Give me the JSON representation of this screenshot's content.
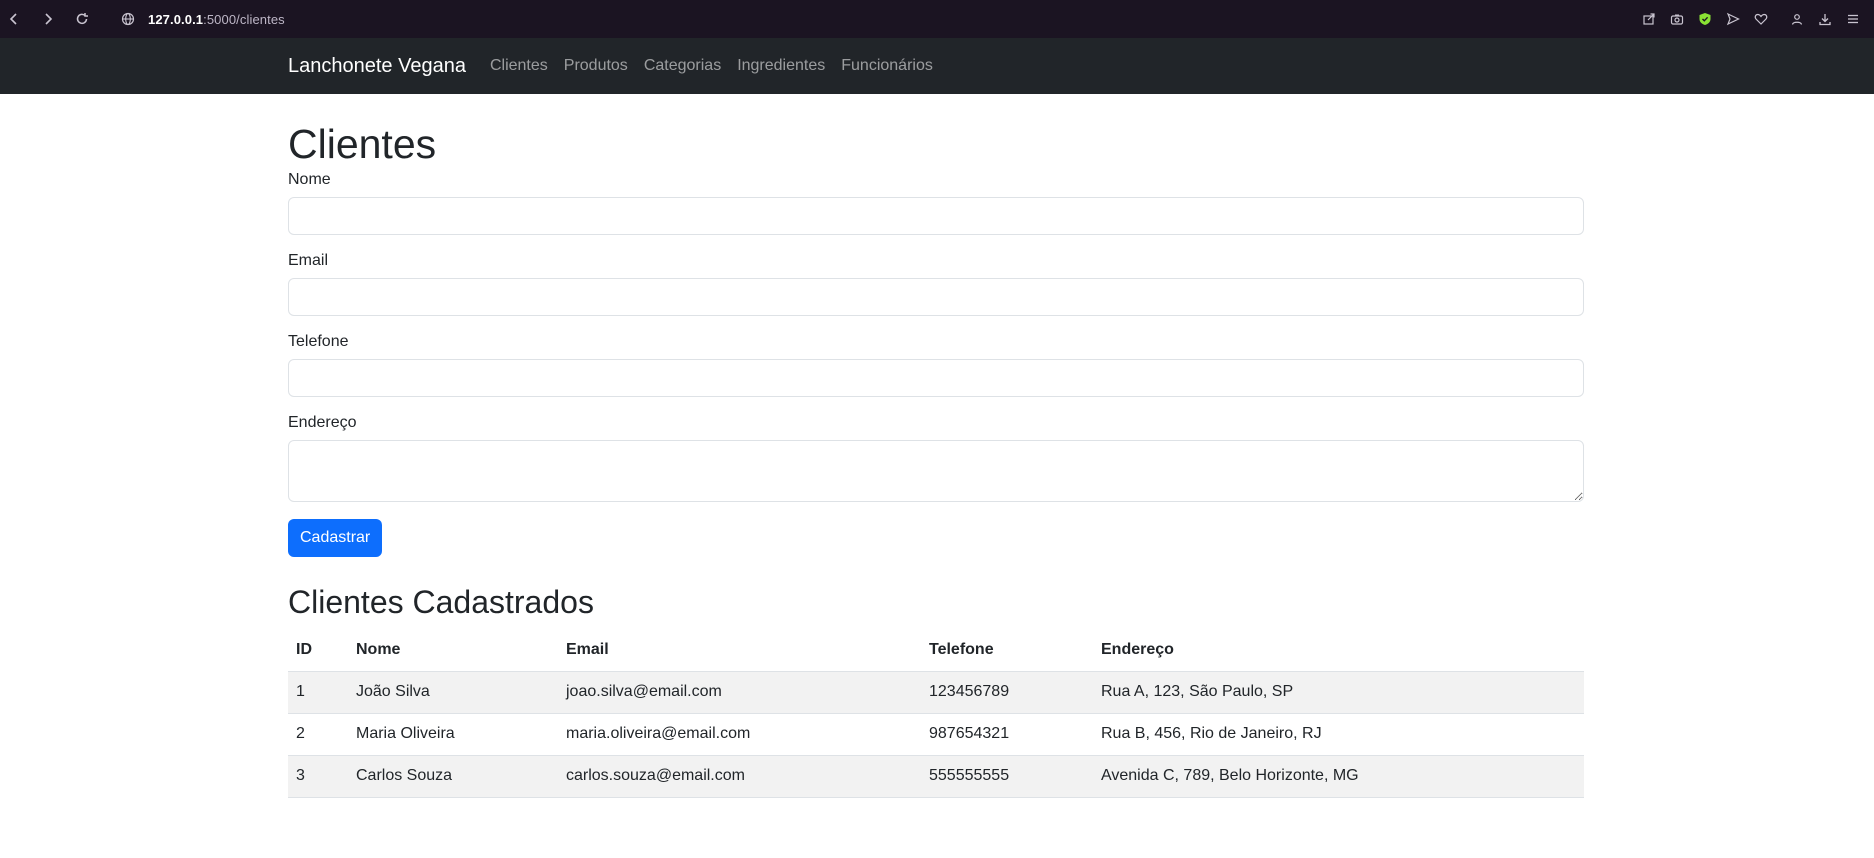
{
  "browser": {
    "url_host": "127.0.0.1",
    "url_path": ":5000/clientes"
  },
  "navbar": {
    "brand": "Lanchonete Vegana",
    "links": [
      "Clientes",
      "Produtos",
      "Categorias",
      "Ingredientes",
      "Funcionários"
    ]
  },
  "main": {
    "title": "Clientes",
    "form": {
      "nome_label": "Nome",
      "nome_value": "",
      "email_label": "Email",
      "email_value": "",
      "telefone_label": "Telefone",
      "telefone_value": "",
      "endereco_label": "Endereço",
      "endereco_value": "",
      "submit_label": "Cadastrar"
    },
    "list_title": "Clientes Cadastrados",
    "table": {
      "headers": [
        "ID",
        "Nome",
        "Email",
        "Telefone",
        "Endereço"
      ],
      "rows": [
        [
          "1",
          "João Silva",
          "joao.silva@email.com",
          "123456789",
          "Rua A, 123, São Paulo, SP"
        ],
        [
          "2",
          "Maria Oliveira",
          "maria.oliveira@email.com",
          "987654321",
          "Rua B, 456, Rio de Janeiro, RJ"
        ],
        [
          "3",
          "Carlos Souza",
          "carlos.souza@email.com",
          "555555555",
          "Avenida C, 789, Belo Horizonte, MG"
        ]
      ]
    }
  },
  "colors": {
    "browser_bar": "#1b1422",
    "navbar": "#212529",
    "primary": "#0d6efd",
    "shield_icon": "#8ae234"
  }
}
